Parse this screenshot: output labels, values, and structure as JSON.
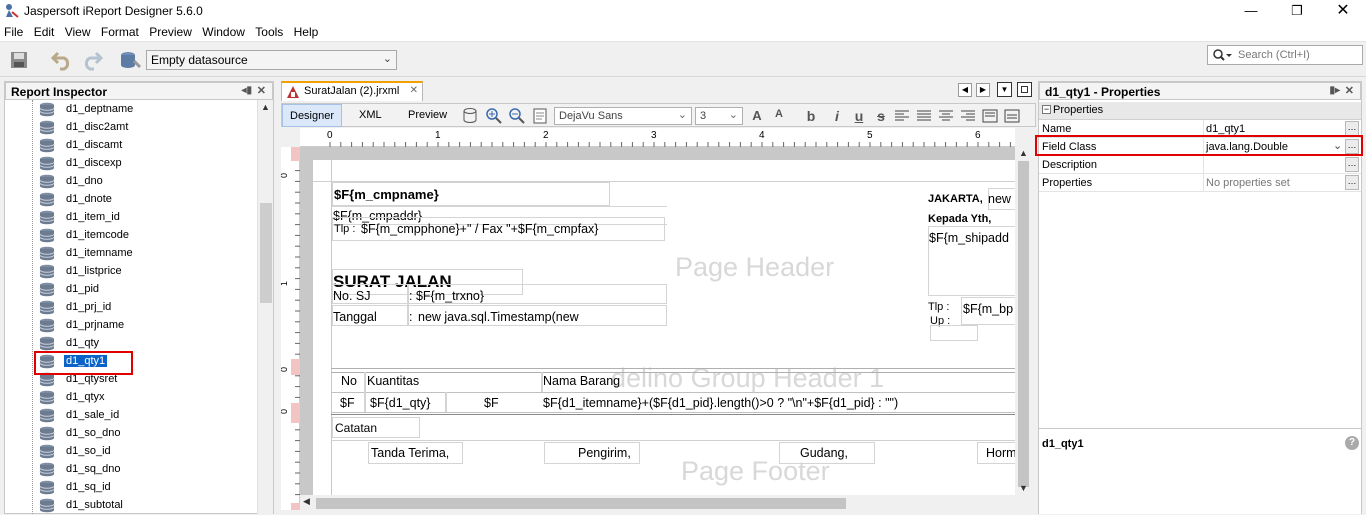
{
  "window": {
    "title": "Jaspersoft iReport Designer 5.6.0"
  },
  "menu": [
    "File",
    "Edit",
    "View",
    "Format",
    "Preview",
    "Window",
    "Tools",
    "Help"
  ],
  "toolbar": {
    "datasource": "Empty datasource"
  },
  "search": {
    "placeholder": "Search (Ctrl+I)"
  },
  "inspector": {
    "title": "Report Inspector",
    "items": [
      "d1_deptname",
      "d1_disc2amt",
      "d1_discamt",
      "d1_discexp",
      "d1_dno",
      "d1_dnote",
      "d1_item_id",
      "d1_itemcode",
      "d1_itemname",
      "d1_listprice",
      "d1_pid",
      "d1_prj_id",
      "d1_prjname",
      "d1_qty",
      "d1_qty1",
      "d1_qtysret",
      "d1_qtyx",
      "d1_sale_id",
      "d1_so_dno",
      "d1_so_id",
      "d1_sq_dno",
      "d1_sq_id",
      "d1_subtotal"
    ],
    "selected": "d1_qty1"
  },
  "editor": {
    "file_tab": "SuratJalan (2).jrxml",
    "tabs": [
      "Designer",
      "XML",
      "Preview"
    ],
    "font": "DejaVu Sans",
    "font_size": "3",
    "format_buttons": [
      "b",
      "i",
      "u",
      "s"
    ],
    "ruler_marks": [
      "0",
      "1",
      "2",
      "3",
      "4",
      "5",
      "6"
    ],
    "left_ruler_marks": [
      "0",
      "1",
      "0",
      "0"
    ]
  },
  "report": {
    "cmpname": "$F{m_cmpname}",
    "cmpaddr": "$F{m_cmpaddr}",
    "tlp_label": "Tlp :",
    "phone": "$F{m_cmpphone}+\" / Fax \"+$F{m_cmpfax}",
    "title": "SURAT JALAN",
    "no_sj_label": "No. SJ",
    "no_sj_value": ": $F{m_trxno}",
    "tanggal_label": "Tanggal",
    "tanggal_colon": ":",
    "tanggal_value": "new java.sql.Timestamp(new",
    "city": "JAKARTA,",
    "city_value": "new",
    "kepada": "Kepada Yth,",
    "shipaddr": "$F{m_shipadd",
    "tlp2_label": "Tlp :",
    "tlp2_value": "$F{m_bp",
    "up_label": "Up :",
    "band_page_header": "Page Header",
    "band_group_header": "delino Group Header 1",
    "band_page_footer": "Page Footer",
    "col_no": "No",
    "col_kuantitas": "Kuantitas",
    "col_nama": "Nama Barang",
    "row_f1": "$F",
    "row_qty": "$F{d1_qty}",
    "row_f2": "$F",
    "row_itemname": "$F{d1_itemname}+($F{d1_pid}.length()>0 ? \"\\n\"+$F{d1_pid} : \"\")",
    "catatan": "Catatan",
    "tanda_terima": "Tanda Terima,",
    "pengirim": "Pengirim,",
    "gudang": "Gudang,",
    "hormat": "Horm"
  },
  "properties": {
    "title": "d1_qty1 - Properties",
    "section": "Properties",
    "rows": [
      {
        "key": "Name",
        "value": "d1_qty1"
      },
      {
        "key": "Field Class",
        "value": "java.lang.Double"
      },
      {
        "key": "Description",
        "value": ""
      },
      {
        "key": "Properties",
        "value": "No properties set"
      }
    ],
    "desc_title": "d1_qty1"
  }
}
